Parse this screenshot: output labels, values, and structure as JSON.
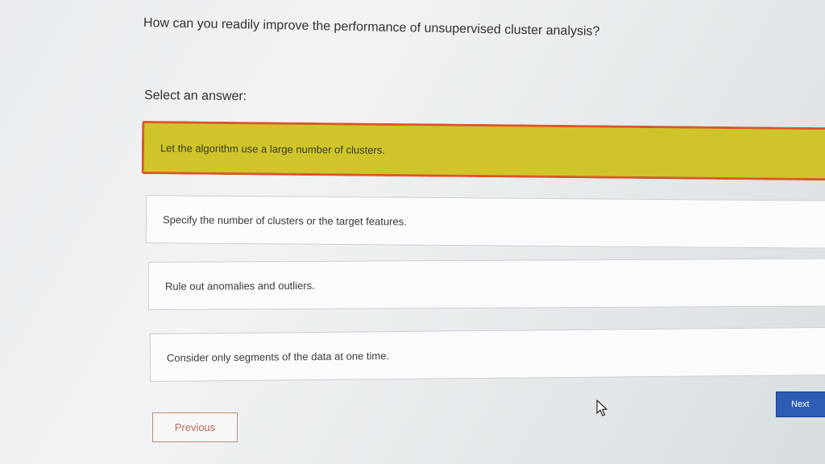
{
  "question": "How can you readily improve the performance of unsupervised cluster analysis?",
  "prompt": "Select an answer:",
  "options": [
    {
      "label": "Let the algorithm use a large number of clusters.",
      "selected": true
    },
    {
      "label": "Specify the number of clusters or the target features.",
      "selected": false
    },
    {
      "label": "Rule out anomalies and outliers.",
      "selected": false
    },
    {
      "label": "Consider only segments of the data at one time.",
      "selected": false
    }
  ],
  "navigation": {
    "previous_label": "Previous",
    "next_label": "Next"
  },
  "colors": {
    "selected_fill": "#cfc52a",
    "selected_border": "#d9572a",
    "next_button": "#2d5db4"
  },
  "icons": {
    "cursor": "mouse-pointer-icon"
  }
}
